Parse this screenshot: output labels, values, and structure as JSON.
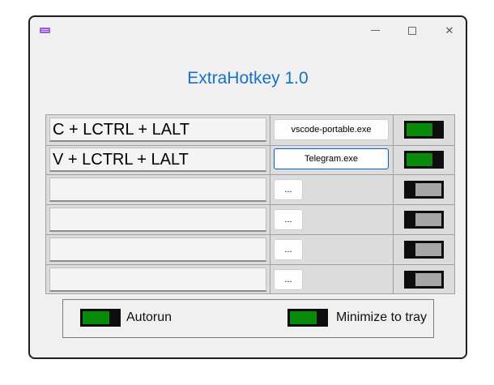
{
  "window": {
    "title": "ExtraHotkey 1.0",
    "controls": {
      "minimize": "minimize-icon",
      "maximize": "maximize-icon",
      "close": "close-icon"
    }
  },
  "rows": [
    {
      "hotkey": "C + LCTRL + LALT",
      "app": "vscode-portable.exe",
      "enabled": true
    },
    {
      "hotkey": "V + LCTRL + LALT",
      "app": "Telegram.exe",
      "enabled": true
    },
    {
      "hotkey": "",
      "app": "...",
      "enabled": false
    },
    {
      "hotkey": "",
      "app": "...",
      "enabled": false
    },
    {
      "hotkey": "",
      "app": "...",
      "enabled": false
    },
    {
      "hotkey": "",
      "app": "...",
      "enabled": false
    }
  ],
  "options": {
    "autorun": {
      "label": "Autorun",
      "enabled": true
    },
    "minimize_to_tray": {
      "label": "Minimize to tray",
      "enabled": true
    }
  },
  "colors": {
    "title": "#1a6fc9",
    "toggle_on": "#0a8a0a",
    "toggle_off": "#a6a6a6",
    "focus_border": "#0a5fc2"
  }
}
